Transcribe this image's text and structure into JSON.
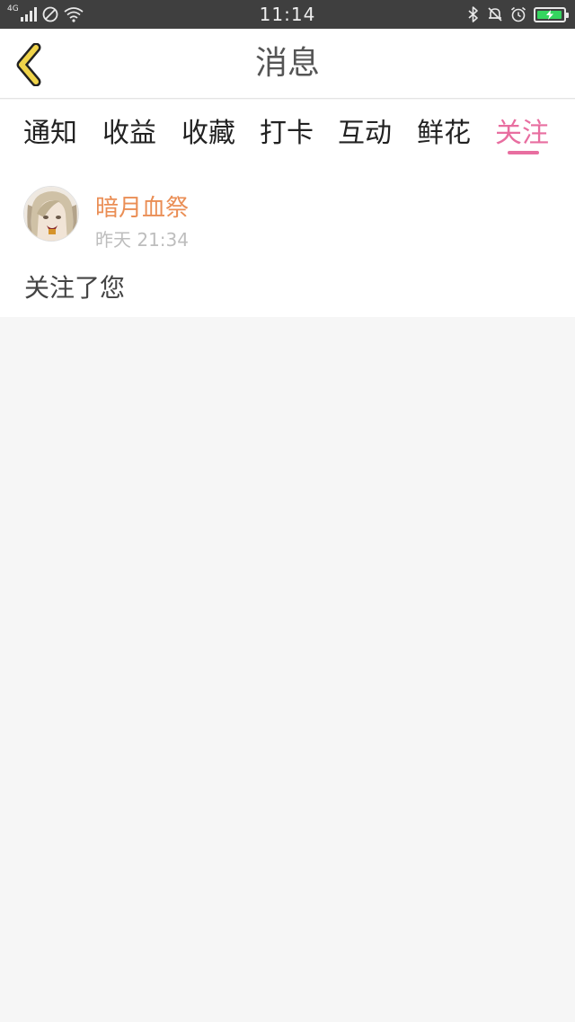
{
  "status_bar": {
    "network_label": "4G",
    "time": "11:14",
    "battery_level": 0.95,
    "battery_color": "#35d55f",
    "icons": [
      "signal-icon",
      "do-not-disturb-icon",
      "wifi-icon",
      "bluetooth-icon",
      "bell-muted-icon",
      "alarm-icon",
      "battery-charging-icon"
    ]
  },
  "header": {
    "back_icon": "chevron-left-icon",
    "title": "消息"
  },
  "tabs": [
    {
      "label": "通知"
    },
    {
      "label": "收益"
    },
    {
      "label": "收藏"
    },
    {
      "label": "打卡"
    },
    {
      "label": "互动"
    },
    {
      "label": "鲜花"
    },
    {
      "label": "关注"
    }
  ],
  "active_tab": "关注",
  "colors": {
    "accent": "#e86ea0",
    "username": "#ea8e55",
    "back_arrow": "#f0d44a"
  },
  "messages": [
    {
      "user": "暗月血祭",
      "time": "昨天 21:34",
      "text": "关注了您"
    }
  ]
}
